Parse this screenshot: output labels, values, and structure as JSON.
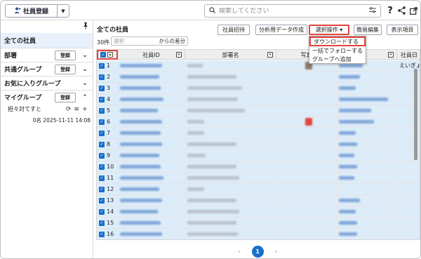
{
  "topbar": {
    "register_label": "社員登録",
    "search_placeholder": "検索してください",
    "help": "?"
  },
  "sidebar": {
    "all_employees": "全ての社員",
    "register_btn": "登録",
    "groups": [
      {
        "label": "部署"
      },
      {
        "label": "共通グループ"
      },
      {
        "label": "お気に入りグループ"
      },
      {
        "label": "マイグループ"
      }
    ],
    "mygroup_item": {
      "name": "担々対てすと",
      "count": "0名",
      "datetime": "2025-11-11 14:08"
    }
  },
  "main": {
    "title": "全ての社員",
    "count": "30件",
    "select_placeholder": "選択",
    "select_suffix": "からの差分",
    "buttons": {
      "invite": "社員招待",
      "analysis": "分析用データ作成",
      "select_ops": "選択操作 ▾",
      "simple_edit": "簡易編集",
      "display_items": "表示項目"
    },
    "dropdown": [
      "ダウンロードする",
      "一括でフォローする",
      "グループへ追加"
    ],
    "columns": [
      "社員ID",
      "部署名",
      "写真",
      "",
      "社員日"
    ],
    "row_numbers": [
      "1",
      "2",
      "3",
      "4",
      "5",
      "6",
      "7",
      "8",
      "9",
      "10",
      "11",
      "12",
      "13",
      "14",
      "15",
      "16"
    ],
    "extra_text": "えいぎょう"
  },
  "pager": {
    "current": "1",
    "prev": "‹",
    "next": "›"
  },
  "colors": {
    "accent": "#1a6fc9",
    "highlight": "#e2453d",
    "row_selected": "#ddecf9"
  }
}
